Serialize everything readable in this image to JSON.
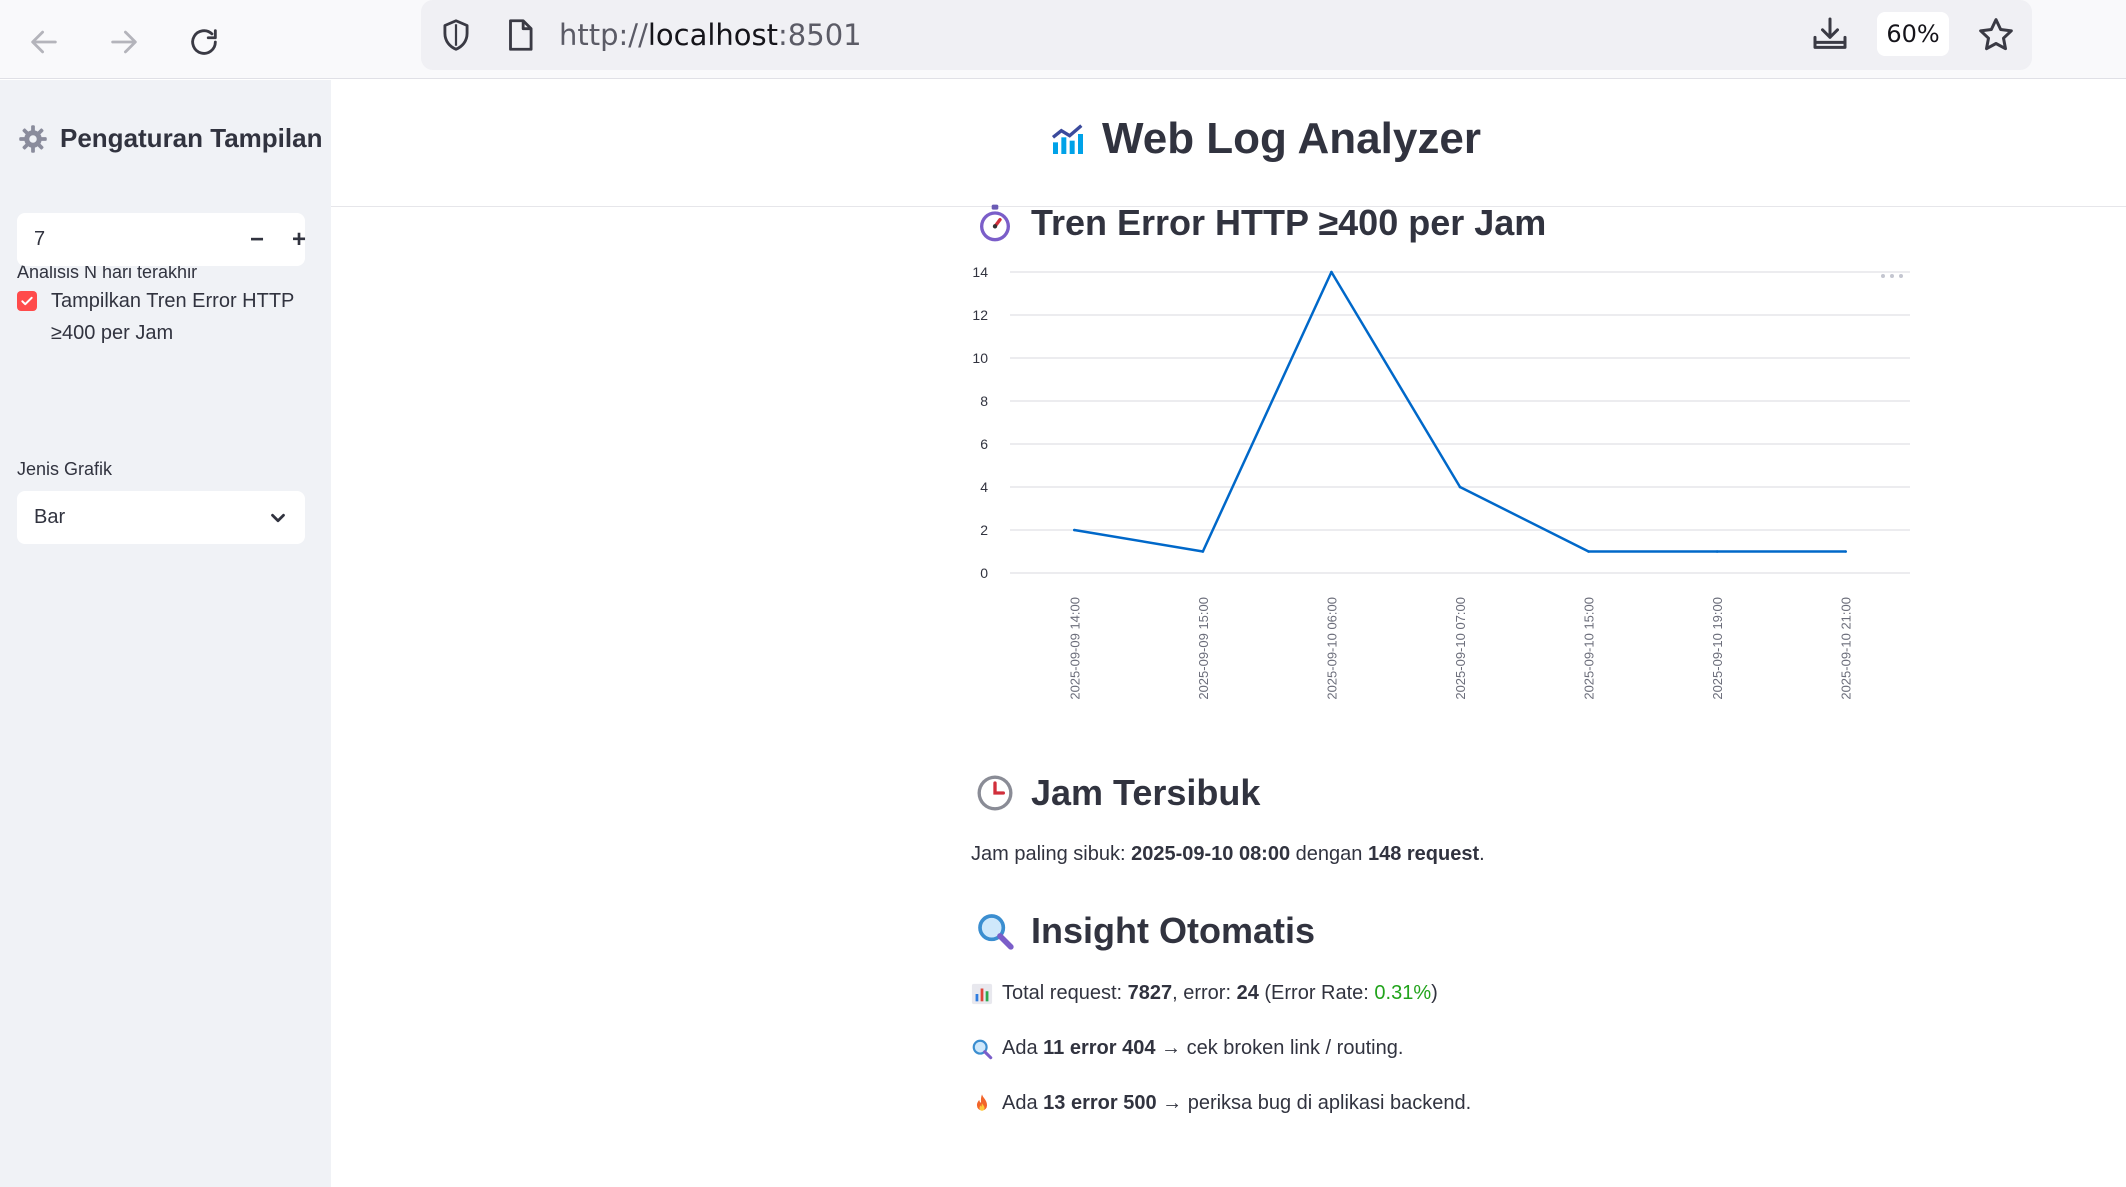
{
  "browser": {
    "url_scheme": "http://",
    "url_host": "localhost",
    "url_port": ":8501",
    "zoom": "60%"
  },
  "sidebar": {
    "title": "Pengaturan Tampilan",
    "days_label": "Analisis N hari terakhir",
    "days_value": "7",
    "days_minus": "−",
    "days_plus": "+",
    "checkbox_label": "Tampilkan Tren Error HTTP ≥400 per Jam",
    "checkbox_checked": true,
    "chart_type_label": "Jenis Grafik",
    "chart_type_value": "Bar"
  },
  "main": {
    "title": "Web Log Analyzer",
    "error_section_title": "Tren Error HTTP ≥400 per Jam",
    "busy_section_title": "Jam Tersibuk",
    "busy_text_prefix": "Jam paling sibuk: ",
    "busy_hour": "2025-09-10 08:00",
    "busy_text_mid": " dengan ",
    "busy_count": "148 request",
    "busy_text_suffix": ".",
    "insight_title": "Insight Otomatis",
    "insight_total_prefix": "Total request: ",
    "insight_total": "7827",
    "insight_error_prefix": ", error: ",
    "insight_error": "24",
    "insight_rate_prefix": " (Error Rate: ",
    "insight_rate": "0.31%",
    "insight_rate_suffix": ")",
    "insight_404_prefix": "Ada ",
    "insight_404": "11 error 404",
    "insight_404_suffix": " → cek broken link / routing.",
    "insight_500_prefix": "Ada ",
    "insight_500": "13 error 500",
    "insight_500_suffix": " → periksa bug di aplikasi backend."
  },
  "chart_data": {
    "type": "line",
    "x": [
      "2025-09-09 14:00",
      "2025-09-09 15:00",
      "2025-09-10 06:00",
      "2025-09-10 07:00",
      "2025-09-10 15:00",
      "2025-09-10 19:00",
      "2025-09-10 21:00"
    ],
    "series": [
      {
        "values": [
          2,
          1,
          14,
          4,
          1,
          1,
          1
        ],
        "color": "#0068c9"
      }
    ],
    "yticks": [
      0,
      2,
      4,
      6,
      8,
      10,
      12,
      14
    ],
    "ylim": [
      0,
      14
    ],
    "grid": true
  }
}
